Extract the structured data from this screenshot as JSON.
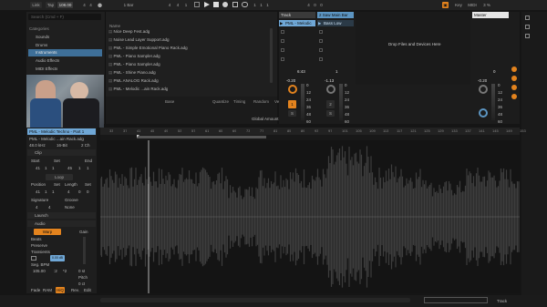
{
  "colors": {
    "accent": "#e3831e",
    "clip": "#6fa7d6",
    "waveform": "#3a3a3a",
    "bg": "#151515"
  },
  "toolbar": {
    "link": "Link",
    "tap": "Tap",
    "tempo": "108.00",
    "sig_num": "4",
    "sig_den": "4",
    "quant": "1 Bar",
    "pos_bars": "4",
    "pos_beats": "4",
    "pos_sixteenths": "1",
    "loop_start": "1",
    "loop_a": "1",
    "loop_b": "1",
    "len_a": "4",
    "len_b": "0",
    "len_c": "0",
    "key": "Key",
    "midi": "MIDI",
    "cpu": "3 %"
  },
  "browser": {
    "search_placeholder": "Search (Cmd + F)",
    "categories_label": "Categories",
    "categories": [
      "Sounds",
      "Drums",
      "Instruments",
      "Audio Effects",
      "MIDI Effects"
    ],
    "name_header": "Name",
    "files": [
      "Nice Deep Fest.adg",
      "Noise Lead Layer Support.adg",
      "PML - Simple Emotional Piano Rack.adg",
      "PML - Piano Sampler.adg",
      "PML - Piano Sampler.adg",
      "PML - Shine Piano.adg",
      "PML ANALOG Rack.adg",
      "PML - Melodic ...ain Rack.adg"
    ],
    "groove_cols": [
      "Base",
      "Quantize",
      "Timing",
      "Random",
      "Velocity"
    ],
    "global_amount_label": "Global Amount",
    "global_amount": "100%"
  },
  "session": {
    "track1": {
      "name": "Track",
      "clip": "PML - Melodic",
      "time": "6:43",
      "volume": "-0.20",
      "number": "1",
      "route": "S"
    },
    "track2": {
      "name": "2 Saw Main Bar",
      "clip": "Bass Low",
      "time": "1",
      "volume": "-1.13",
      "number": "2",
      "route": "S"
    },
    "drop_text": "Drop Files and Devices Here",
    "master": {
      "name": "Master",
      "volume": "-0.20",
      "time": "0"
    },
    "meter_ticks": [
      "0",
      "12",
      "24",
      "36",
      "48",
      "60"
    ]
  },
  "clip_view": {
    "clip_name": "PML - Melodic Techno - Part 1",
    "file_name": "PML - Melodic ...ain Rack.adg",
    "sample_rate": "48.0 kHz",
    "bit_depth": "16-Bit",
    "channels": "2 Ch",
    "clip_label": "Clip",
    "start_label": "Start",
    "set_label": "Set",
    "end_label": "End",
    "start_vals": [
      "41",
      "1",
      "1"
    ],
    "end_vals": [
      "45",
      "1",
      "1"
    ],
    "loop_label": "Loop",
    "position_label": "Position",
    "length_label": "Length",
    "position_vals": [
      "41",
      "1",
      "1"
    ],
    "length_vals": [
      "4",
      "0",
      "0"
    ],
    "signature_label": "Signature",
    "groove_label": "Groove",
    "signature_vals": [
      "4",
      "4"
    ],
    "groove_val": "None",
    "launch_label": "Launch",
    "audio_label": "Audio",
    "warp_label": "Warp",
    "gain_label": "Gain",
    "mode": "Beats",
    "preserve_label": "Preserve",
    "preserve_val": "Transients",
    "seg_bpm_label": "Seg. BPM",
    "bpm_val": "105.00",
    "pitch_val": "0 st",
    "pitch_label": "Pitch",
    "detune_val": "0 ct",
    "fade_label": "Fade",
    "ram_label": "RAM",
    "hiq_label": "HiQ",
    "edit_label": "Edit",
    "gain_val": "0.00 dB"
  },
  "timeline": {
    "ticks": [
      "33",
      "37",
      "41",
      "45",
      "49",
      "53",
      "57",
      "61",
      "65",
      "69",
      "73",
      "77",
      "81",
      "85",
      "89",
      "93",
      "97",
      "101",
      "105",
      "109",
      "113",
      "117",
      "121",
      "125",
      "129",
      "133",
      "137",
      "141",
      "145",
      "149",
      "153"
    ]
  },
  "status": {
    "track_label": "Track"
  }
}
